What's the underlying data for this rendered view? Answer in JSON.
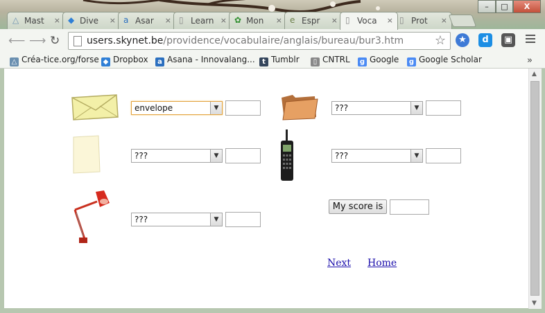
{
  "tabs": [
    {
      "label": "Mast",
      "icon": "triangle-icon",
      "color": "#6a8fb0"
    },
    {
      "label": "Dive",
      "icon": "dropbox-icon",
      "color": "#2f7fd6"
    },
    {
      "label": "Asar",
      "icon": "asana-icon",
      "color": "#2b6fbf"
    },
    {
      "label": "Learn",
      "icon": "page-icon",
      "color": "#888888"
    },
    {
      "label": "Mon",
      "icon": "flower-icon",
      "color": "#2f8f2f"
    },
    {
      "label": "Espr",
      "icon": "e-icon",
      "color": "#6b7f4a"
    },
    {
      "label": "Voca",
      "icon": "page-icon",
      "color": "#888888",
      "active": true
    },
    {
      "label": "Prot",
      "icon": "page-icon",
      "color": "#888888"
    }
  ],
  "window": {
    "minimize": "–",
    "maximize": "□",
    "close": "X"
  },
  "address": {
    "host": "users.skynet.be",
    "path": "/providence/vocabulaire/anglais/bureau/bur3.htm"
  },
  "bookmarks": [
    {
      "label": "Créa-tice.org/forse",
      "icon": "triangle-icon",
      "color": "#6a8fb0"
    },
    {
      "label": "Dropbox",
      "icon": "dropbox-icon",
      "color": "#2f7fd6"
    },
    {
      "label": "Asana - Innovalang...",
      "icon": "asana-icon",
      "color": "#2b6fbf"
    },
    {
      "label": "Tumblr",
      "icon": "tumblr-icon",
      "color": "#35465c"
    },
    {
      "label": "CNTRL",
      "icon": "page-icon",
      "color": "#888888"
    },
    {
      "label": "Google",
      "icon": "google-icon",
      "color": "#4a8af4"
    },
    {
      "label": "Google Scholar",
      "icon": "google-icon",
      "color": "#4a8af4"
    }
  ],
  "bookmarks_more": "»",
  "quiz": {
    "items": [
      {
        "picture": "envelope-icon",
        "selected": "envelope"
      },
      {
        "picture": "folder-icon",
        "selected": "???"
      },
      {
        "picture": "paper-icon",
        "selected": "???"
      },
      {
        "picture": "mobile-phone-icon",
        "selected": "???"
      },
      {
        "picture": "desk-lamp-icon",
        "selected": "???"
      }
    ],
    "score_button": "My score is",
    "score_value": ""
  },
  "links": {
    "next": "Next",
    "home": "Home"
  }
}
